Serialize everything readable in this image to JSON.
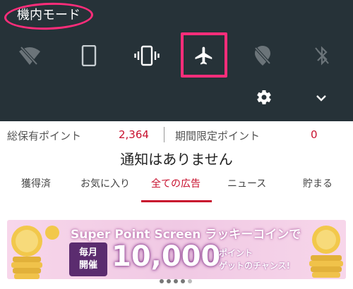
{
  "status": {
    "mode_title": "機内モード"
  },
  "quick_tiles": [
    {
      "name": "wifi-off-icon",
      "state": "off"
    },
    {
      "name": "phone-icon",
      "state": "on"
    },
    {
      "name": "vibrate-icon",
      "state": "on"
    },
    {
      "name": "airplane-icon",
      "state": "on",
      "highlighted": true
    },
    {
      "name": "location-off-icon",
      "state": "off"
    },
    {
      "name": "bluetooth-off-icon",
      "state": "off"
    }
  ],
  "colors": {
    "shade_bg": "#263238",
    "highlight": "#ff2d7a",
    "accent_red": "#c8102e"
  },
  "points": {
    "total_label": "総保有ポイント",
    "total_value": "2,364",
    "limited_label": "期間限定ポイント",
    "limited_value": "0"
  },
  "notification_text": "通知はありません",
  "tabs": [
    {
      "label": "獲得済",
      "active": false
    },
    {
      "label": "お気に入り",
      "active": false
    },
    {
      "label": "全ての広告",
      "active": true
    },
    {
      "label": "ニュース",
      "active": false
    },
    {
      "label": "貯まる",
      "active": false
    }
  ],
  "banner": {
    "title": "Super Point Screen ラッキーコインで",
    "badge_line1": "毎月",
    "badge_line2": "開催",
    "big_number": "10,000",
    "small_line1": "ポイント",
    "small_line2": "ゲットのチャンス!"
  },
  "pager": {
    "count": 5,
    "active_index": 4
  }
}
